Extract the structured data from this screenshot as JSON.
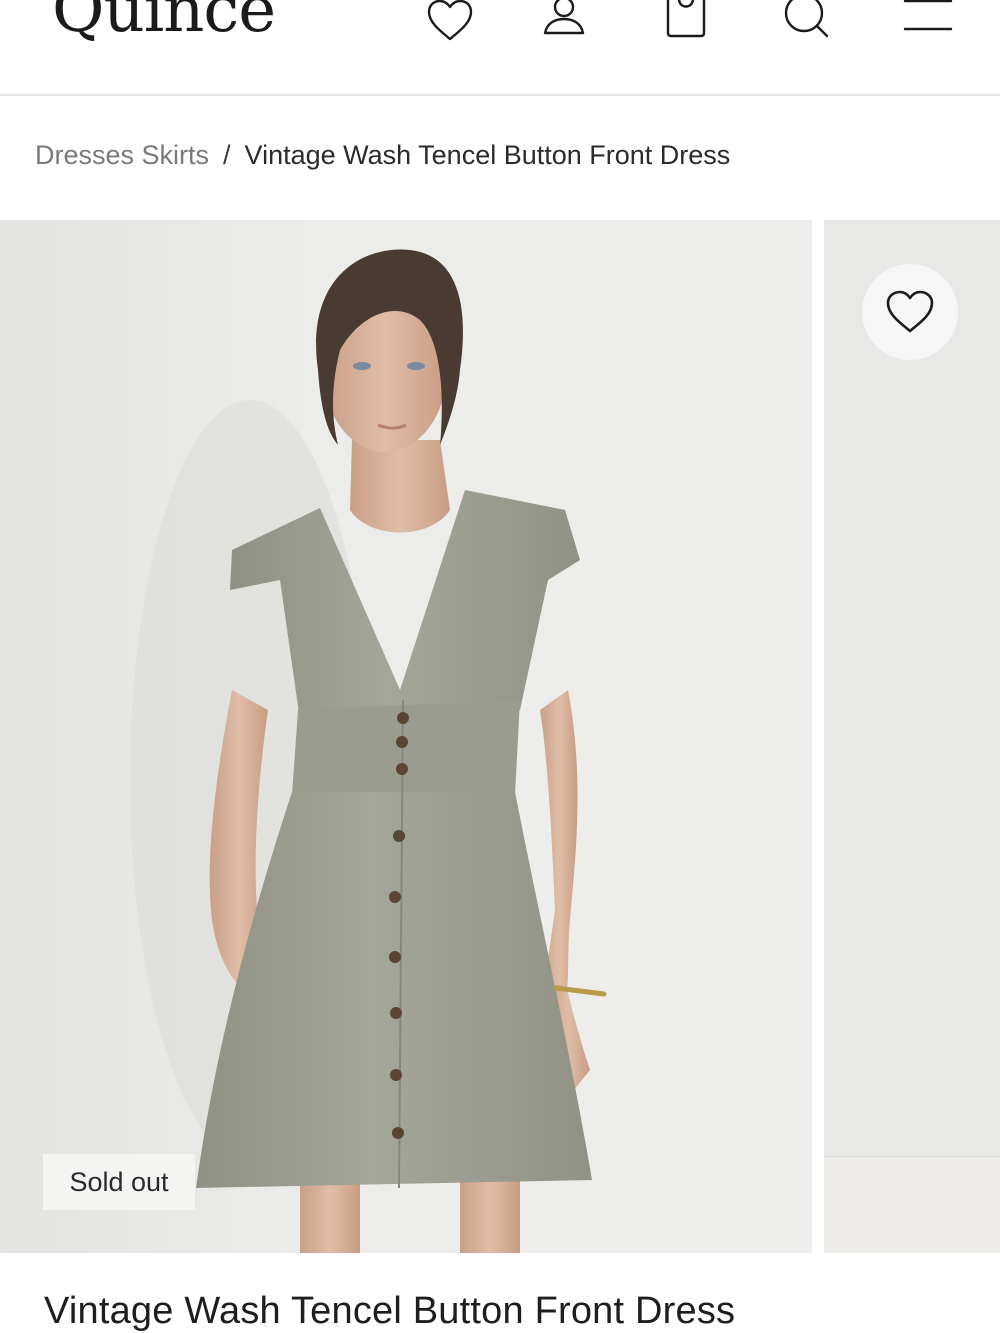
{
  "brand": {
    "logo_text": "Quince"
  },
  "header": {
    "icons": [
      "heart-icon",
      "account-icon",
      "shopping-bag-icon",
      "search-icon",
      "menu-icon"
    ]
  },
  "breadcrumb": {
    "parent": "Dresses Skirts",
    "separator": "/",
    "current": "Vintage Wash Tencel Button Front Dress"
  },
  "gallery": {
    "badge": "Sold out",
    "wishlist_icon": "heart-icon"
  },
  "product": {
    "title": "Vintage Wash Tencel Button Front Dress"
  },
  "colors": {
    "text": "#1f1f1f",
    "muted": "#7a7a7a",
    "divider": "#e3e3e3",
    "photo_bg": "#ececea",
    "dress": "#9d9f92"
  }
}
